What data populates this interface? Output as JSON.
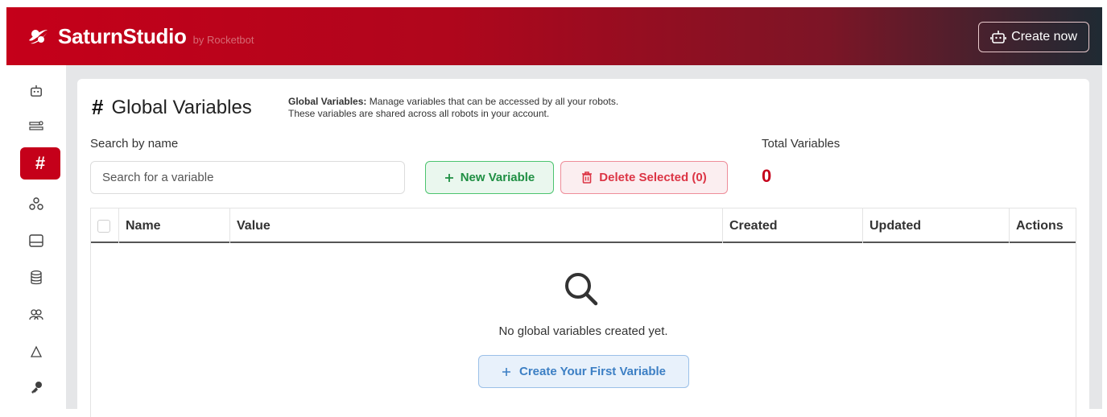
{
  "header": {
    "brand": "SaturnStudio",
    "brand_by": "by Rocketbot",
    "create_now": "Create now"
  },
  "sidebar": {
    "items": [
      {
        "icon": "robot-icon"
      },
      {
        "icon": "bot-list-icon"
      },
      {
        "icon": "hash-icon",
        "label": "#",
        "active": true
      },
      {
        "icon": "webhook-icon"
      },
      {
        "icon": "storage-icon"
      },
      {
        "icon": "database-icon"
      },
      {
        "icon": "users-icon"
      },
      {
        "icon": "network-icon"
      },
      {
        "icon": "key-icon"
      }
    ]
  },
  "page": {
    "title_hash": "#",
    "title": "Global Variables",
    "desc_bold": "Global Variables:",
    "desc_line1": " Manage variables that can be accessed by all your robots.",
    "desc_line2": "These variables are shared across all robots in your account."
  },
  "search": {
    "label": "Search by name",
    "placeholder": "Search for a variable"
  },
  "buttons": {
    "new_variable": "New Variable",
    "delete_selected": "Delete Selected (0)",
    "create_first": "Create Your First Variable"
  },
  "totals": {
    "label": "Total Variables",
    "value": "0"
  },
  "table": {
    "columns": [
      "Name",
      "Value",
      "Created",
      "Updated",
      "Actions"
    ],
    "empty_text": "No global variables created yet."
  },
  "colors": {
    "brand_red": "#c5001a",
    "green": "#1f8f43",
    "danger": "#dc3545",
    "info": "#3c7fc4"
  }
}
